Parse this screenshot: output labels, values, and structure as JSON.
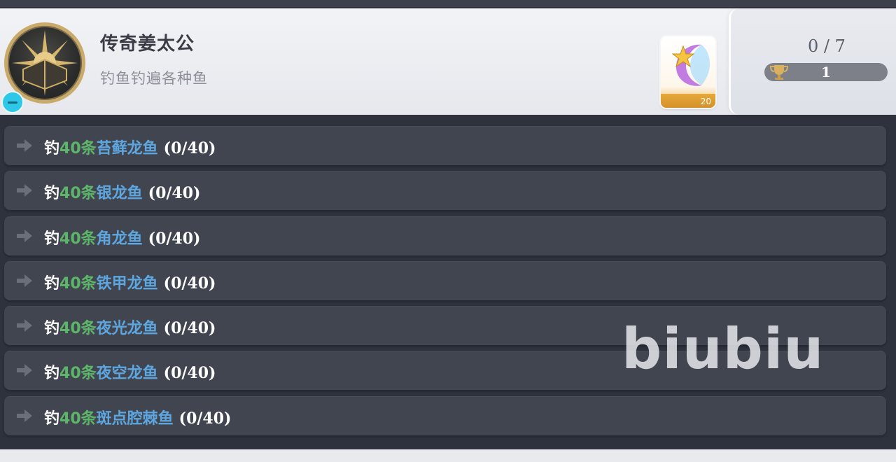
{
  "achievement": {
    "title": "传奇姜太公",
    "description": "钓鱼钓遍各种鱼",
    "progress": "0 / 7",
    "trophy_count": "1",
    "reward_quantity": "20"
  },
  "colors": {
    "count_color": "#5db56a",
    "fish_color": "#5ea6df",
    "row_background": "#41454f",
    "badge_color": "#2fc7e8"
  },
  "tasks": [
    {
      "verb": "钓",
      "count": "40条",
      "fish": "苔藓龙鱼",
      "progress": "(0/40)"
    },
    {
      "verb": "钓",
      "count": "40条",
      "fish": "银龙鱼",
      "progress": "(0/40)"
    },
    {
      "verb": "钓",
      "count": "40条",
      "fish": "角龙鱼",
      "progress": "(0/40)"
    },
    {
      "verb": "钓",
      "count": "40条",
      "fish": "铁甲龙鱼",
      "progress": "(0/40)"
    },
    {
      "verb": "钓",
      "count": "40条",
      "fish": "夜光龙鱼",
      "progress": "(0/40)"
    },
    {
      "verb": "钓",
      "count": "40条",
      "fish": "夜空龙鱼",
      "progress": "(0/40)"
    },
    {
      "verb": "钓",
      "count": "40条",
      "fish": "斑点腔棘鱼",
      "progress": "(0/40)"
    }
  ],
  "watermark": "biubiu",
  "icons": {
    "emblem": "sun-emblem-icon",
    "badge": "minus-icon",
    "reward": "star-moon-reward-icon",
    "trophy": "trophy-icon",
    "row": "arrow-right-icon"
  }
}
